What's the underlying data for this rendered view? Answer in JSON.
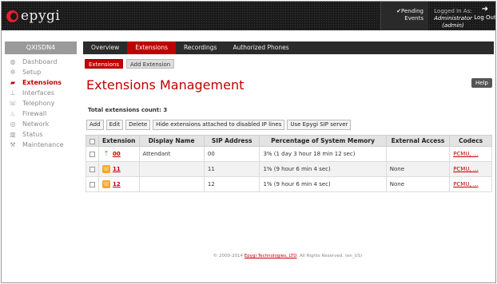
{
  "header": {
    "logo_text": "epygi",
    "pending_line1": "✔Pending",
    "pending_line2": "Events",
    "login_line1": "Logged In As:",
    "login_line2": "Administrator (admin)",
    "logout_label": "Log Out"
  },
  "sidebar": {
    "device": "QXISDN4",
    "items": [
      {
        "label": "Dashboard",
        "icon": "dashboard-icon",
        "glyph": "◍"
      },
      {
        "label": "Setup",
        "icon": "gear-icon",
        "glyph": "✲"
      },
      {
        "label": "Extensions",
        "icon": "extensions-icon",
        "glyph": "▰"
      },
      {
        "label": "Interfaces",
        "icon": "interfaces-icon",
        "glyph": "⊥"
      },
      {
        "label": "Telephony",
        "icon": "phone-icon",
        "glyph": "☏"
      },
      {
        "label": "Firewall",
        "icon": "firewall-icon",
        "glyph": "♨"
      },
      {
        "label": "Network",
        "icon": "network-icon",
        "glyph": "◎"
      },
      {
        "label": "Status",
        "icon": "status-icon",
        "glyph": "▥"
      },
      {
        "label": "Maintenance",
        "icon": "wrench-icon",
        "glyph": "⚒"
      }
    ]
  },
  "tabs": [
    "Overview",
    "Extensions",
    "Recordings",
    "Authorized Phones"
  ],
  "subtabs": [
    "Extensions",
    "Add Extension"
  ],
  "help_label": "Help",
  "page_title": "Extensions Management",
  "count_label": "Total extensions count: 3",
  "toolbar": [
    "Add",
    "Edit",
    "Delete",
    "Hide extensions attached to disabled IP lines",
    "Use Epygi SIP server"
  ],
  "table": {
    "columns": [
      "",
      "Extension",
      "Display Name",
      "SIP Address",
      "Percentage of System Memory",
      "External Access",
      "Codecs"
    ],
    "rows": [
      {
        "icon": "attendant-icon",
        "glyph": "⇡",
        "extension": "00",
        "display_name": "Attendant",
        "sip": "00",
        "memory": "3% (1 day 3 hour 18 min 12 sec)",
        "external": "",
        "codecs": "PCMU, ..."
      },
      {
        "icon": "phone-icon",
        "glyph": "☏",
        "extension": "11",
        "display_name": "",
        "sip": "11",
        "memory": "1% (9 hour 6 min 4 sec)",
        "external": "None",
        "codecs": "PCMU, ..."
      },
      {
        "icon": "phone-icon",
        "glyph": "☏",
        "extension": "12",
        "display_name": "",
        "sip": "12",
        "memory": "1% (9 hour 6 min 4 sec)",
        "external": "None",
        "codecs": "PCMU, ..."
      }
    ]
  },
  "footer": {
    "prefix": "© 2000-2014 ",
    "company": "Epygi Technologies, LTD",
    "suffix": ". All Rights Reserved. (en_US)"
  }
}
